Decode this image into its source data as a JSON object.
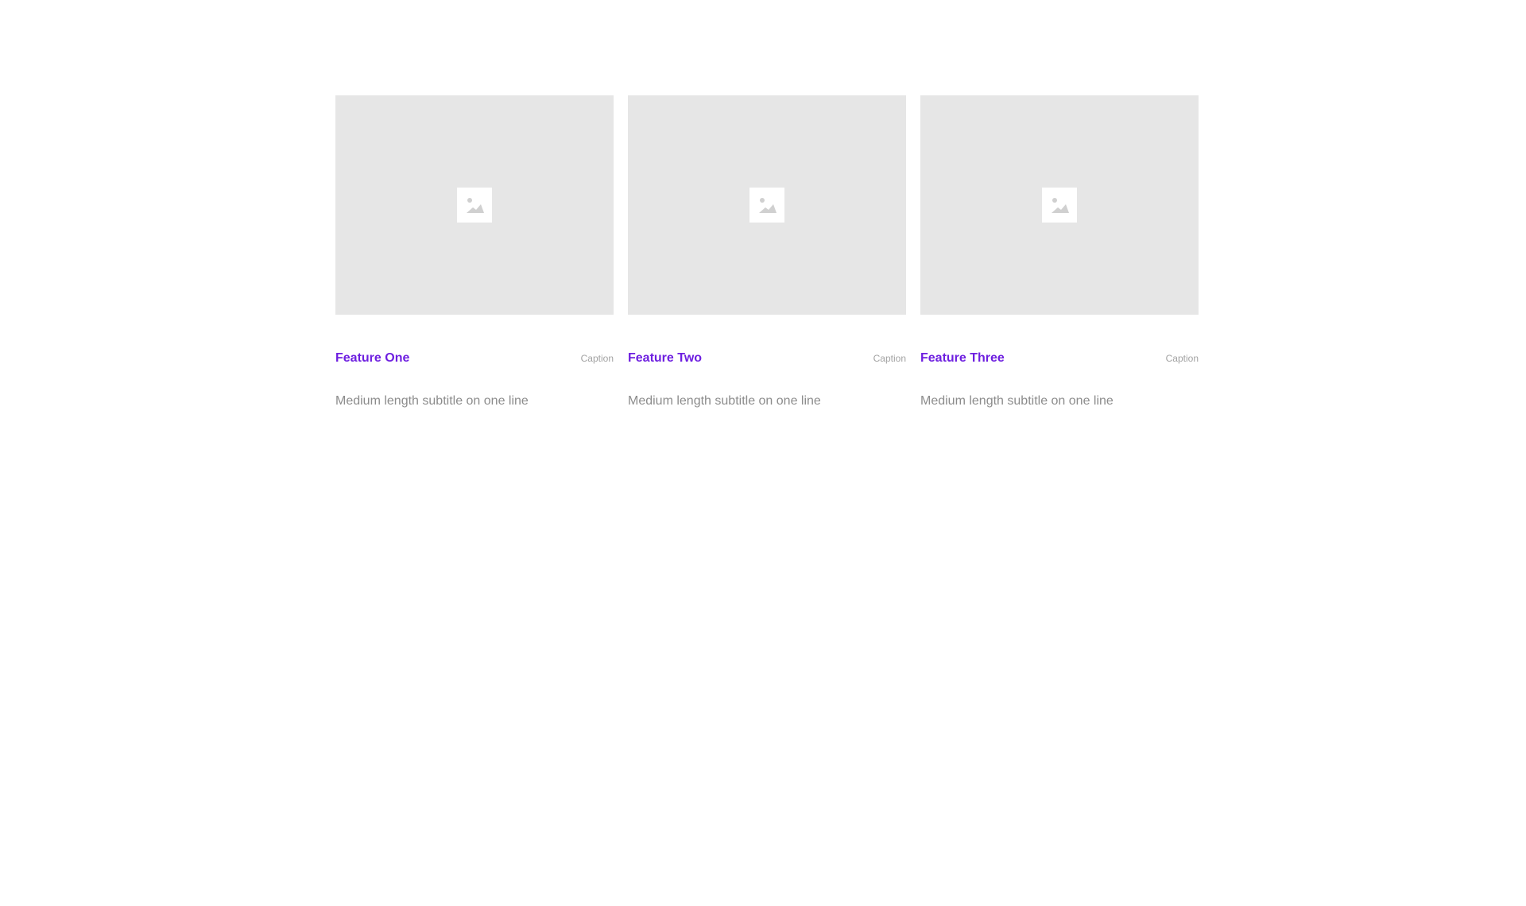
{
  "colors": {
    "accent": "#6e1fe0",
    "placeholder_bg": "#e6e6e6",
    "caption": "#a2a2a2",
    "subtitle": "#8c8c8c"
  },
  "features": [
    {
      "icon": "image-placeholder-icon",
      "title": "Feature One",
      "caption": "Caption",
      "subtitle": "Medium length subtitle on one line"
    },
    {
      "icon": "image-placeholder-icon",
      "title": "Feature Two",
      "caption": "Caption",
      "subtitle": "Medium length subtitle on one line"
    },
    {
      "icon": "image-placeholder-icon",
      "title": "Feature Three",
      "caption": "Caption",
      "subtitle": "Medium length subtitle on one line"
    }
  ]
}
